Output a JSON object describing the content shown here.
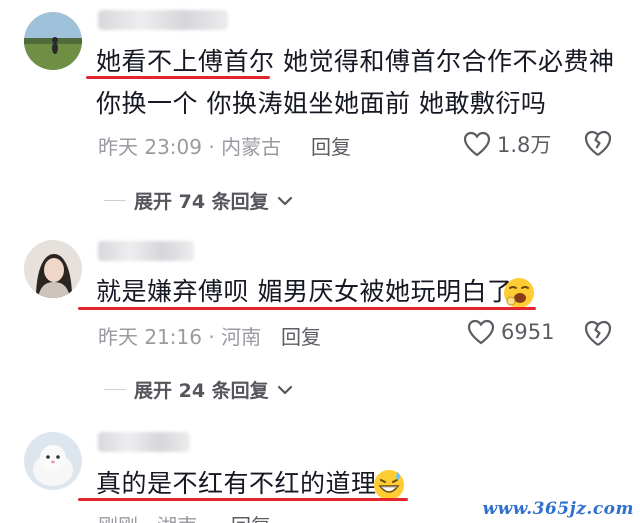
{
  "comments": [
    {
      "text_line1": "她看不上傅首尔  她觉得和傅首尔合作不必费神",
      "text_line2": "你换一个  你换涛姐坐她面前  她敢敷衍吗",
      "meta": "昨天 23:09 · 内蒙古",
      "reply_label": "回复",
      "likes": "1.8万",
      "expand_label": "展开 74 条回复"
    },
    {
      "text_line1": "就是嫌弃傅呗 媚男厌女被她玩明白了",
      "meta": "昨天 21:16 · 河南",
      "reply_label": "回复",
      "likes": "6951",
      "expand_label": "展开 24 条回复"
    },
    {
      "text_line1": "真的是不红有不红的道理",
      "meta": "刚刚 · 湖南",
      "reply_label": "回复"
    }
  ],
  "colors": {
    "highlight_underline": "#e5252d",
    "meta_gray": "#9a9ba1"
  },
  "watermark": "www.365jz.com"
}
